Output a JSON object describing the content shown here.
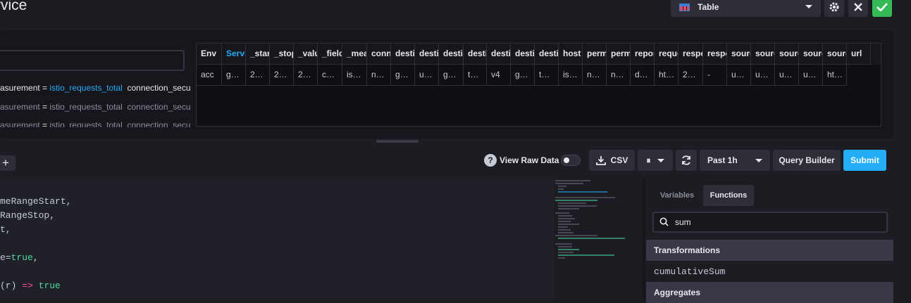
{
  "header": {
    "title": "rvice"
  },
  "toolbar": {
    "visualization": "Table",
    "gear_icon": "gear-icon",
    "close_icon": "close-icon",
    "save_icon": "check-icon"
  },
  "series": [
    {
      "key": "asurement",
      "eq": "=",
      "value": "istio_requests_total",
      "next": "connection_secu"
    },
    {
      "key": "asurement",
      "eq": "=",
      "value": "istio_requests_total",
      "next": "connection_secu"
    },
    {
      "key": "asurement",
      "eq": "=",
      "value": "istio_requests_total",
      "next": "connection_secu"
    }
  ],
  "table": {
    "headers": [
      "Env",
      "Servi",
      "_star",
      "_stop",
      "_valu",
      "_field",
      "_mea",
      "conn",
      "desti",
      "desti",
      "desti",
      "desti",
      "desti",
      "desti",
      "desti",
      "host",
      "perm",
      "perm",
      "repor",
      "reque",
      "respo",
      "respo",
      "sourc",
      "sourc",
      "sourc",
      "sourc",
      "sourc",
      "url"
    ],
    "widths": [
      36,
      34,
      34,
      34,
      34,
      35,
      35,
      34,
      34,
      34,
      35,
      33,
      34,
      34,
      34,
      34,
      34,
      34,
      34,
      34,
      35,
      34,
      34,
      34,
      34,
      34,
      34,
      34
    ],
    "row": [
      "acc",
      "g…",
      "2…",
      "2…",
      "2…",
      "c…",
      "is…",
      "n…",
      "g…",
      "u…",
      "g…",
      "t…",
      "v4",
      "g…",
      "t…",
      "is…",
      "n…",
      "n…",
      "d…",
      "ht…",
      "2…",
      "-",
      "u…",
      "u…",
      "u…",
      "u…",
      "ht…"
    ]
  },
  "controls": {
    "add_label": "+",
    "view_raw_label": "View Raw Data",
    "csv_label": "CSV",
    "pause_label": "⏸",
    "time_range": "Past 1h",
    "query_builder_label": "Query Builder",
    "submit_label": "Submit"
  },
  "code": [
    {
      "text": "meRangeStart,"
    },
    {
      "text": "RangeStop,"
    },
    {
      "text": "t,"
    },
    {
      "text": ""
    },
    {
      "pre": "e=",
      "kw": "true",
      "post": ","
    },
    {
      "text": ""
    },
    {
      "pre": "(r) ",
      "op": "=>",
      "kw": "true"
    }
  ],
  "sidebar": {
    "tabs": [
      "Variables",
      "Functions"
    ],
    "search_value": "sum",
    "categories": [
      "Transformations",
      "Aggregates"
    ],
    "functions": [
      "cumulativeSum"
    ]
  }
}
